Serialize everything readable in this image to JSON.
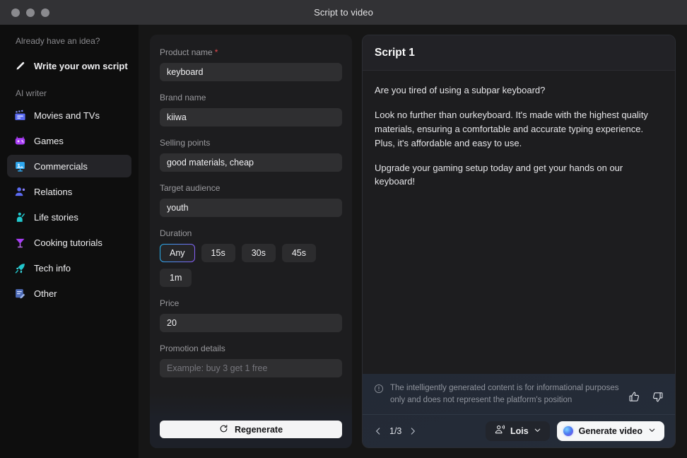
{
  "window": {
    "title": "Script to video",
    "controls": [
      "close",
      "minimize",
      "maximize"
    ]
  },
  "sidebar": {
    "heading_idea": "Already have an idea?",
    "write_own": {
      "label": "Write your own script",
      "icon": "pencil-icon"
    },
    "heading_ai": "AI writer",
    "items": [
      {
        "label": "Movies and TVs",
        "icon": "clapperboard-icon",
        "active": false
      },
      {
        "label": "Games",
        "icon": "game-controller-icon",
        "active": false
      },
      {
        "label": "Commercials",
        "icon": "billboard-icon",
        "active": true
      },
      {
        "label": "Relations",
        "icon": "person-add-icon",
        "active": false
      },
      {
        "label": "Life stories",
        "icon": "person-wave-icon",
        "active": false
      },
      {
        "label": "Cooking tutorials",
        "icon": "cocktail-icon",
        "active": false
      },
      {
        "label": "Tech info",
        "icon": "rocket-icon",
        "active": false
      },
      {
        "label": "Other",
        "icon": "note-edit-icon",
        "active": false
      }
    ]
  },
  "form": {
    "fields": [
      {
        "label": "Product name",
        "required": true,
        "value": "keyboard",
        "placeholder": ""
      },
      {
        "label": "Brand name",
        "required": false,
        "value": "kiiwa",
        "placeholder": ""
      },
      {
        "label": "Selling points",
        "required": false,
        "value": "good materials, cheap",
        "placeholder": ""
      },
      {
        "label": "Target audience",
        "required": false,
        "value": "youth",
        "placeholder": ""
      }
    ],
    "duration": {
      "label": "Duration",
      "options": [
        "Any",
        "15s",
        "30s",
        "45s",
        "1m"
      ],
      "selected": "Any"
    },
    "price": {
      "label": "Price",
      "value": "20"
    },
    "promotion": {
      "label": "Promotion details",
      "value": "",
      "placeholder": "Example: buy 3 get 1 free"
    },
    "regenerate": {
      "label": "Regenerate",
      "icon": "refresh-icon"
    }
  },
  "script": {
    "title": "Script 1",
    "paragraphs": [
      "Are you tired of using a subpar keyboard?",
      "Look no further than ourkeyboard. It's made with the highest quality materials, ensuring a comfortable and accurate typing experience. Plus, it's affordable and easy to use.",
      "Upgrade your gaming setup today and get your hands on our keyboard!"
    ],
    "disclaimer": {
      "icon": "info-circle-icon",
      "text": "The intelligently generated content is for informational purposes only and does not represent the platform's position"
    },
    "feedback": {
      "like": "thumbs-up-icon",
      "dislike": "thumbs-down-icon"
    },
    "pagination": {
      "current": "1/3",
      "prev": "chevron-left-icon",
      "next": "chevron-right-icon"
    },
    "voice": {
      "label": "Lois",
      "icon": "voice-icon",
      "chevron": "chevron-down-icon"
    },
    "generate": {
      "label": "Generate video",
      "icon": "ai-orb-icon",
      "chevron": "chevron-down-icon"
    }
  },
  "colors": {
    "accent_blue": "#24b0e8",
    "accent_purple": "#8b5cf6",
    "required_red": "#e5484d",
    "sidebar_bg": "#0e0e0e",
    "panel_bg": "#1d1d1f",
    "input_bg": "#2f2f31"
  }
}
